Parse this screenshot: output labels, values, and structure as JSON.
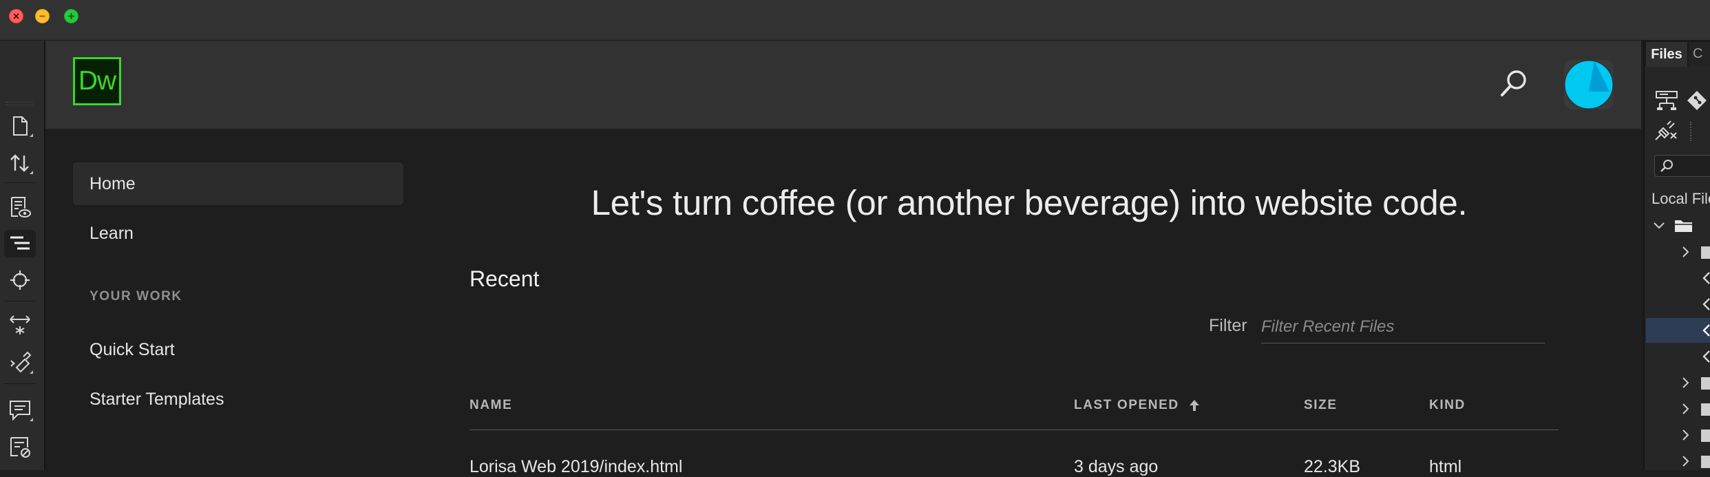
{
  "app": {
    "logo_text": "Dw"
  },
  "window_controls": [
    "close",
    "minimize",
    "maximize"
  ],
  "toolbar": {
    "tools": [
      {
        "name": "new-document-icon"
      },
      {
        "name": "file-transfer-icon"
      },
      {
        "name": "live-view-icon"
      },
      {
        "name": "dom-panel-icon",
        "active": true
      },
      {
        "name": "inspect-icon"
      },
      {
        "name": "element-resize-icon"
      },
      {
        "name": "extract-icon"
      },
      {
        "name": "comment-icon"
      },
      {
        "name": "validate-icon"
      }
    ]
  },
  "sidebar": {
    "home": "Home",
    "learn": "Learn",
    "section_heading": "YOUR WORK",
    "quick_start": "Quick Start",
    "starter_templates": "Starter Templates"
  },
  "main": {
    "headline": "Let's turn coffee (or another beverage) into website code.",
    "recent_title": "Recent",
    "filter_label": "Filter",
    "filter_placeholder": "Filter Recent Files",
    "columns": {
      "name": "NAME",
      "last_opened": "LAST OPENED",
      "size": "SIZE",
      "kind": "KIND"
    },
    "rows": [
      {
        "name": "Lorisa Web 2019/index.html",
        "last_opened": "3 days ago",
        "size": "22.3KB",
        "kind": "html"
      }
    ]
  },
  "files_panel": {
    "tab_label": "Files",
    "second_tab_label": "C",
    "section_label": "Local Files"
  },
  "colors": {
    "accent_green": "#3bd62c",
    "avatar_cyan": "#00c8f0",
    "selection_blue": "#2e3c55"
  }
}
